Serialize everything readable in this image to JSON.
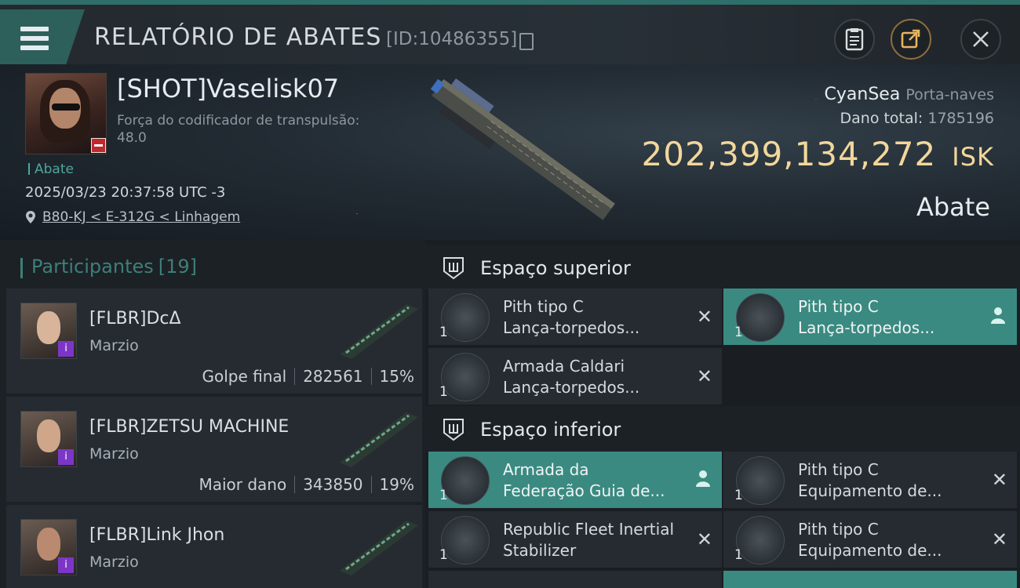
{
  "header": {
    "title": "RELATÓRIO DE ABATES",
    "id": "[ID:10486355]",
    "buttons": [
      "clipboard-icon",
      "share-icon",
      "close-icon"
    ]
  },
  "victim": {
    "name": "[SHOT]Vaselisk07",
    "attribute_label": "Força do codificador de transpulsão:",
    "attribute_value": "48.0",
    "tag": "Abate",
    "datetime": "2025/03/23 20:37:58 UTC -3",
    "location": "B80-KJ < E-312G < Linhagem",
    "ship_name": "CyanSea",
    "ship_class": "Porta-naves",
    "damage_label": "Dano total:",
    "damage_value": "1785196",
    "isk_value": "202,399,134,272",
    "isk_unit": "ISK",
    "result": "Abate"
  },
  "participants": {
    "label": "Participantes",
    "count": "[19]",
    "rows": [
      {
        "name": "[FLBR]DcΔ",
        "corp": "Marzio",
        "stat_label": "Golpe final",
        "damage": "282561",
        "percent": "15%"
      },
      {
        "name": "[FLBR]ZETSU MACHINE",
        "corp": "Marzio",
        "stat_label": "Maior dano",
        "damage": "343850",
        "percent": "19%"
      },
      {
        "name": "[FLBR]Link Jhon",
        "corp": "Marzio",
        "stat_label": "",
        "damage": "",
        "percent": ""
      }
    ]
  },
  "sections": {
    "upper": {
      "title": "Espaço superior",
      "slots": [
        {
          "qty": "1",
          "line1": "Pith tipo C",
          "line2": "Lança-torpedos...",
          "state": "destroyed"
        },
        {
          "qty": "1",
          "line1": "Pith tipo C",
          "line2": "Lança-torpedos...",
          "state": "dropped"
        },
        {
          "qty": "1",
          "line1": "Armada Caldari",
          "line2": "Lança-torpedos...",
          "state": "destroyed"
        }
      ]
    },
    "lower": {
      "title": "Espaço inferior",
      "slots": [
        {
          "qty": "1",
          "line1": "Armada da",
          "line2": "Federação Guia de...",
          "state": "dropped"
        },
        {
          "qty": "1",
          "line1": "Pith tipo C",
          "line2": "Equipamento de...",
          "state": "destroyed"
        },
        {
          "qty": "1",
          "line1": "Republic Fleet Inertial",
          "line2": "Stabilizer",
          "state": "destroyed"
        },
        {
          "qty": "1",
          "line1": "Pith tipo C",
          "line2": "Equipamento de...",
          "state": "destroyed"
        }
      ]
    }
  },
  "colors": {
    "accent": "#3a8a81",
    "isk": "#f2d79b",
    "destroyed_badge": "#c3282e",
    "corp_badge": "#7c36c7"
  }
}
